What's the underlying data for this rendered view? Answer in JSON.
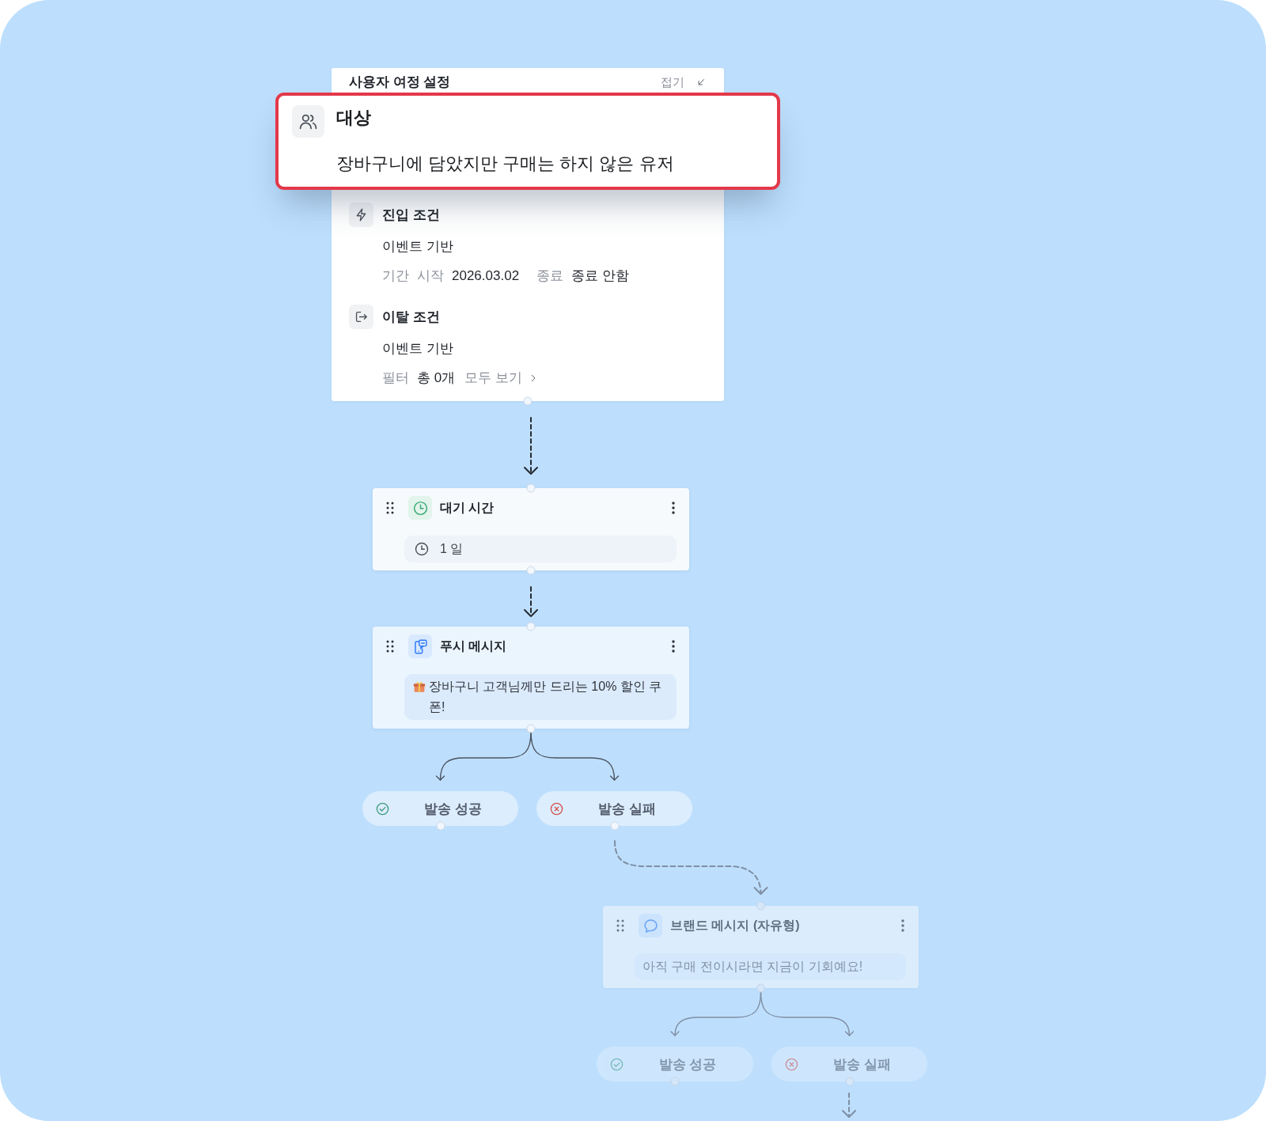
{
  "panel": {
    "title": "사용자 여정 설정",
    "collapse_label": "접기"
  },
  "audience": {
    "label": "대상",
    "value": "장바구니에 담았지만 구매는 하지 않은 유저",
    "highlighted": true
  },
  "entry_condition": {
    "title": "진입 조건",
    "trigger": "이벤트 기반",
    "period_label": "기간",
    "start_label": "시작",
    "start_date": "2026.03.02",
    "end_label": "종료",
    "end_value": "종료 안함"
  },
  "exit_condition": {
    "title": "이탈 조건",
    "trigger": "이벤트 기반",
    "filter_label": "필터",
    "filter_count": "총 0개",
    "view_all": "모두 보기"
  },
  "flow": [
    {
      "kind": "wait",
      "title": "대기 시간",
      "detail": "1 일",
      "dimmed": false
    },
    {
      "kind": "push",
      "title": "푸시 메시지",
      "detail": "장바구니 고객님께만 드리는 10% 할인 쿠폰!",
      "dimmed": false,
      "branches": [
        {
          "kind": "success",
          "label": "발송 성공",
          "dimmed": false
        },
        {
          "kind": "failure",
          "label": "발송 실패",
          "dimmed": false
        }
      ]
    },
    {
      "kind": "brand_message",
      "title": "브랜드 메시지 (자유형)",
      "detail": "아직 구매 전이시라면 지금이 기회예요!",
      "dimmed": true,
      "branches": [
        {
          "kind": "success",
          "label": "발송 성공",
          "dimmed": true
        },
        {
          "kind": "failure",
          "label": "발송 실패",
          "dimmed": true
        }
      ]
    }
  ]
}
